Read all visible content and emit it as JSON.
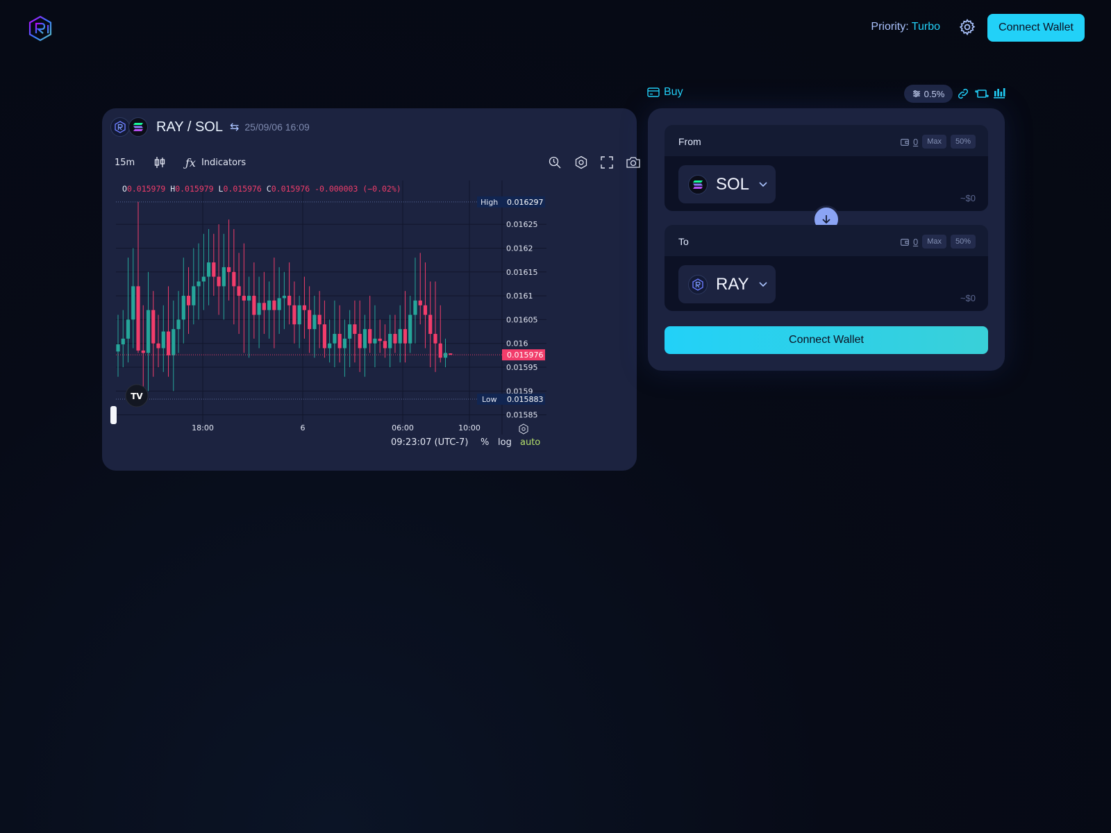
{
  "header": {
    "priority_label": "Priority:",
    "priority_value": "Turbo",
    "connect_label": "Connect Wallet"
  },
  "chart_panel": {
    "base_symbol": "RAY",
    "quote_symbol": "SOL",
    "pair_name": "RAY / SOL",
    "timestamp": "25/09/06 16:09",
    "interval": "15m",
    "indicators_label": "Indicators",
    "ohlc": {
      "o_label": "O",
      "o": "0.015979",
      "h_label": "H",
      "h": "0.015979",
      "l_label": "L",
      "l": "0.015976",
      "c_label": "C",
      "c": "0.015976",
      "change": "-0.000003 (−0.02%)"
    },
    "high_label": "High",
    "low_label": "Low",
    "clock": "09:23:07 (UTC-7)",
    "percent_label": "%",
    "log_label": "log",
    "auto_label": "auto"
  },
  "chart_data": {
    "type": "candlestick",
    "y_axis_ticks": [
      "0.01625",
      "0.0162",
      "0.01615",
      "0.0161",
      "0.01605",
      "0.016",
      "0.01595",
      "0.0159",
      "0.01585"
    ],
    "x_axis_ticks": [
      "18:00",
      "6",
      "06:00",
      "10:00"
    ],
    "high_value": "0.016297",
    "low_value": "0.015883",
    "last_price": "0.015976",
    "colors": {
      "up": "#26a69a",
      "down": "#f23d6b"
    },
    "candles": [
      {
        "o": 0.015983,
        "h": 0.01606,
        "l": 0.01593,
        "c": 0.015998
      },
      {
        "o": 0.015998,
        "h": 0.01607,
        "l": 0.01595,
        "c": 0.01601
      },
      {
        "o": 0.01601,
        "h": 0.01618,
        "l": 0.01596,
        "c": 0.01605
      },
      {
        "o": 0.01605,
        "h": 0.0162,
        "l": 0.01599,
        "c": 0.01612
      },
      {
        "o": 0.01612,
        "h": 0.016297,
        "l": 0.01598,
        "c": 0.015985
      },
      {
        "o": 0.015985,
        "h": 0.01608,
        "l": 0.015883,
        "c": 0.01598
      },
      {
        "o": 0.01598,
        "h": 0.01615,
        "l": 0.0159,
        "c": 0.01607
      },
      {
        "o": 0.01607,
        "h": 0.01611,
        "l": 0.01593,
        "c": 0.016
      },
      {
        "o": 0.016,
        "h": 0.01606,
        "l": 0.01595,
        "c": 0.01599
      },
      {
        "o": 0.01599,
        "h": 0.01608,
        "l": 0.01594,
        "c": 0.016025
      },
      {
        "o": 0.016025,
        "h": 0.01612,
        "l": 0.01593,
        "c": 0.015975
      },
      {
        "o": 0.015975,
        "h": 0.01609,
        "l": 0.0159,
        "c": 0.01603
      },
      {
        "o": 0.01603,
        "h": 0.01611,
        "l": 0.01598,
        "c": 0.01605
      },
      {
        "o": 0.01605,
        "h": 0.01618,
        "l": 0.016,
        "c": 0.0161
      },
      {
        "o": 0.0161,
        "h": 0.01616,
        "l": 0.01602,
        "c": 0.01608
      },
      {
        "o": 0.01608,
        "h": 0.0162,
        "l": 0.01604,
        "c": 0.01612
      },
      {
        "o": 0.01612,
        "h": 0.01621,
        "l": 0.01605,
        "c": 0.01613
      },
      {
        "o": 0.01613,
        "h": 0.01623,
        "l": 0.01607,
        "c": 0.01614
      },
      {
        "o": 0.01614,
        "h": 0.01624,
        "l": 0.01608,
        "c": 0.01617
      },
      {
        "o": 0.01617,
        "h": 0.01623,
        "l": 0.0161,
        "c": 0.01614
      },
      {
        "o": 0.01614,
        "h": 0.01625,
        "l": 0.01606,
        "c": 0.01612
      },
      {
        "o": 0.01612,
        "h": 0.01623,
        "l": 0.01605,
        "c": 0.01616
      },
      {
        "o": 0.01616,
        "h": 0.01626,
        "l": 0.01609,
        "c": 0.01615
      },
      {
        "o": 0.01615,
        "h": 0.01624,
        "l": 0.01604,
        "c": 0.01612
      },
      {
        "o": 0.01612,
        "h": 0.01619,
        "l": 0.01602,
        "c": 0.0161
      },
      {
        "o": 0.0161,
        "h": 0.01621,
        "l": 0.01598,
        "c": 0.01609
      },
      {
        "o": 0.01609,
        "h": 0.01614,
        "l": 0.01597,
        "c": 0.0161
      },
      {
        "o": 0.0161,
        "h": 0.01617,
        "l": 0.01601,
        "c": 0.01606
      },
      {
        "o": 0.01606,
        "h": 0.01614,
        "l": 0.01599,
        "c": 0.016085
      },
      {
        "o": 0.016085,
        "h": 0.01615,
        "l": 0.01602,
        "c": 0.01607
      },
      {
        "o": 0.01607,
        "h": 0.01613,
        "l": 0.01601,
        "c": 0.01609
      },
      {
        "o": 0.01609,
        "h": 0.01618,
        "l": 0.01599,
        "c": 0.01607
      },
      {
        "o": 0.01607,
        "h": 0.01616,
        "l": 0.01602,
        "c": 0.016095
      },
      {
        "o": 0.016095,
        "h": 0.01615,
        "l": 0.01603,
        "c": 0.0161
      },
      {
        "o": 0.0161,
        "h": 0.01617,
        "l": 0.01604,
        "c": 0.01608
      },
      {
        "o": 0.01608,
        "h": 0.01613,
        "l": 0.016,
        "c": 0.01604
      },
      {
        "o": 0.01604,
        "h": 0.0161,
        "l": 0.01599,
        "c": 0.01608
      },
      {
        "o": 0.01608,
        "h": 0.01614,
        "l": 0.01601,
        "c": 0.01607
      },
      {
        "o": 0.01607,
        "h": 0.01612,
        "l": 0.01598,
        "c": 0.01603
      },
      {
        "o": 0.01603,
        "h": 0.0161,
        "l": 0.01597,
        "c": 0.01606
      },
      {
        "o": 0.01606,
        "h": 0.01611,
        "l": 0.01599,
        "c": 0.01604
      },
      {
        "o": 0.01604,
        "h": 0.01609,
        "l": 0.01597,
        "c": 0.01599
      },
      {
        "o": 0.01599,
        "h": 0.01605,
        "l": 0.01596,
        "c": 0.016
      },
      {
        "o": 0.016,
        "h": 0.01609,
        "l": 0.01595,
        "c": 0.01602
      },
      {
        "o": 0.01602,
        "h": 0.01608,
        "l": 0.01596,
        "c": 0.01599
      },
      {
        "o": 0.01599,
        "h": 0.01605,
        "l": 0.01593,
        "c": 0.01601
      },
      {
        "o": 0.01601,
        "h": 0.01607,
        "l": 0.01595,
        "c": 0.01604
      },
      {
        "o": 0.01604,
        "h": 0.01609,
        "l": 0.01596,
        "c": 0.01602
      },
      {
        "o": 0.01602,
        "h": 0.01609,
        "l": 0.01594,
        "c": 0.01599
      },
      {
        "o": 0.01599,
        "h": 0.01606,
        "l": 0.01593,
        "c": 0.01603
      },
      {
        "o": 0.01603,
        "h": 0.0161,
        "l": 0.01598,
        "c": 0.016
      },
      {
        "o": 0.016,
        "h": 0.01608,
        "l": 0.01595,
        "c": 0.01601
      },
      {
        "o": 0.01601,
        "h": 0.01605,
        "l": 0.01598,
        "c": 0.016005
      },
      {
        "o": 0.016005,
        "h": 0.01604,
        "l": 0.01597,
        "c": 0.01599
      },
      {
        "o": 0.01599,
        "h": 0.01606,
        "l": 0.01595,
        "c": 0.01602
      },
      {
        "o": 0.01602,
        "h": 0.01606,
        "l": 0.01598,
        "c": 0.016
      },
      {
        "o": 0.016,
        "h": 0.01608,
        "l": 0.01596,
        "c": 0.01603
      },
      {
        "o": 0.01603,
        "h": 0.01611,
        "l": 0.01596,
        "c": 0.016
      },
      {
        "o": 0.016,
        "h": 0.0161,
        "l": 0.01598,
        "c": 0.01606
      },
      {
        "o": 0.01606,
        "h": 0.01618,
        "l": 0.016,
        "c": 0.01609
      },
      {
        "o": 0.01609,
        "h": 0.01619,
        "l": 0.01604,
        "c": 0.01608
      },
      {
        "o": 0.01608,
        "h": 0.01617,
        "l": 0.01599,
        "c": 0.01606
      },
      {
        "o": 0.01606,
        "h": 0.01613,
        "l": 0.01595,
        "c": 0.01602
      },
      {
        "o": 0.01602,
        "h": 0.01613,
        "l": 0.01594,
        "c": 0.016
      },
      {
        "o": 0.016,
        "h": 0.01608,
        "l": 0.01596,
        "c": 0.01597
      },
      {
        "o": 0.01597,
        "h": 0.01601,
        "l": 0.01595,
        "c": 0.01598
      },
      {
        "o": 0.015979,
        "h": 0.015979,
        "l": 0.015976,
        "c": 0.015976
      }
    ]
  },
  "swap": {
    "buy_label": "Buy",
    "slippage": "0.5%",
    "from": {
      "label": "From",
      "balance": "0",
      "max_label": "Max",
      "half_label": "50%",
      "token": "SOL",
      "usd": "~$0"
    },
    "to": {
      "label": "To",
      "balance": "0",
      "max_label": "Max",
      "half_label": "50%",
      "token": "RAY",
      "usd": "~$0"
    },
    "connect_label": "Connect Wallet"
  }
}
